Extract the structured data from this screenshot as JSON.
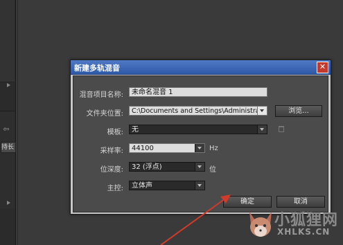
{
  "dialog": {
    "title": "新建多轨混音",
    "close_icon": "close-icon",
    "fields": {
      "session_name": {
        "label": "混音项目名称:",
        "value": "未命名混音 1"
      },
      "folder": {
        "label": "文件夹位置:",
        "value": "C:\\Documents and Settings\\Administrator...",
        "browse_label": "浏览..."
      },
      "template": {
        "label": "模板:",
        "value": "无"
      },
      "sample_rate": {
        "label": "采样率:",
        "value": "44100",
        "unit": "Hz"
      },
      "bit_depth": {
        "label": "位深度:",
        "value": "32 (浮点)",
        "unit": "位"
      },
      "master": {
        "label": "主控:",
        "value": "立体声"
      }
    },
    "ok_label": "确定",
    "cancel_label": "取消"
  },
  "background": {
    "hold_label": "持长"
  },
  "watermark": {
    "cn": "小狐狸网",
    "en": "XHLKS.CN"
  },
  "colors": {
    "titlebar": "#3b66b5",
    "panel": "#4b4b4b",
    "annotation_arrow": "#d23a2a"
  }
}
